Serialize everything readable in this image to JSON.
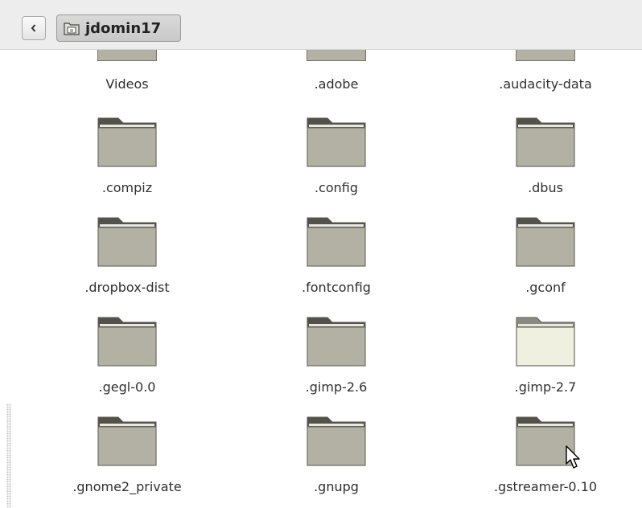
{
  "toolbar": {
    "back_label": "‹",
    "location": "jdomin17"
  },
  "files": {
    "top_partial": [
      "Videos",
      ".adobe",
      ".audacity-data"
    ],
    "items": [
      ".compiz",
      ".config",
      ".dbus",
      ".dropbox-dist",
      ".fontconfig",
      ".gconf",
      ".gegl-0.0",
      ".gimp-2.6",
      ".gimp-2.7",
      ".gnome2_private",
      ".gnupg",
      ".gstreamer-0.10"
    ],
    "hovered": ".gimp-2.7"
  },
  "colors": {
    "folder_fill": "#b2b1a4",
    "folder_tab": "#52524a",
    "folder_hover_fill": "#f0f0e0"
  }
}
